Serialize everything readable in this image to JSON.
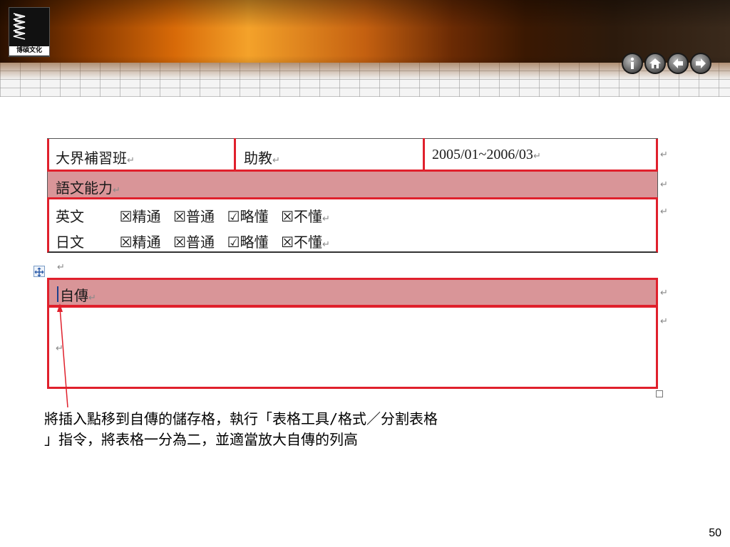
{
  "header": {
    "logo_text": "博碩文化",
    "nav_buttons": [
      {
        "name": "info-icon",
        "label": "i"
      },
      {
        "name": "home-icon",
        "label": "home"
      },
      {
        "name": "back-arrow-icon",
        "label": "back"
      },
      {
        "name": "forward-arrow-icon",
        "label": "forward"
      }
    ]
  },
  "table1": {
    "row1": {
      "col1": "大界補習班",
      "col2": "助教",
      "col3": "2005/01~2006/03"
    },
    "row2": {
      "title": "語文能力"
    },
    "row3": {
      "line1": {
        "lang": "英文",
        "opts": [
          "☒精通",
          "☒普通",
          "☑略懂",
          "☒不懂"
        ]
      },
      "line2": {
        "lang": "日文",
        "opts": [
          "☒精通",
          "☒普通",
          "☑略懂",
          "☒不懂"
        ]
      }
    }
  },
  "table2": {
    "row1": {
      "title": "自傳"
    }
  },
  "marks": {
    "return": "↵"
  },
  "caption": {
    "line1": "將插入點移到自傳的儲存格，執行「表格工具/格式／分割表格",
    "line2": "」指令，將表格一分為二，並適當放大自傳的列高"
  },
  "page_number": "50",
  "colors": {
    "accent_red": "#e0202c",
    "pink_fill": "#d99598"
  }
}
